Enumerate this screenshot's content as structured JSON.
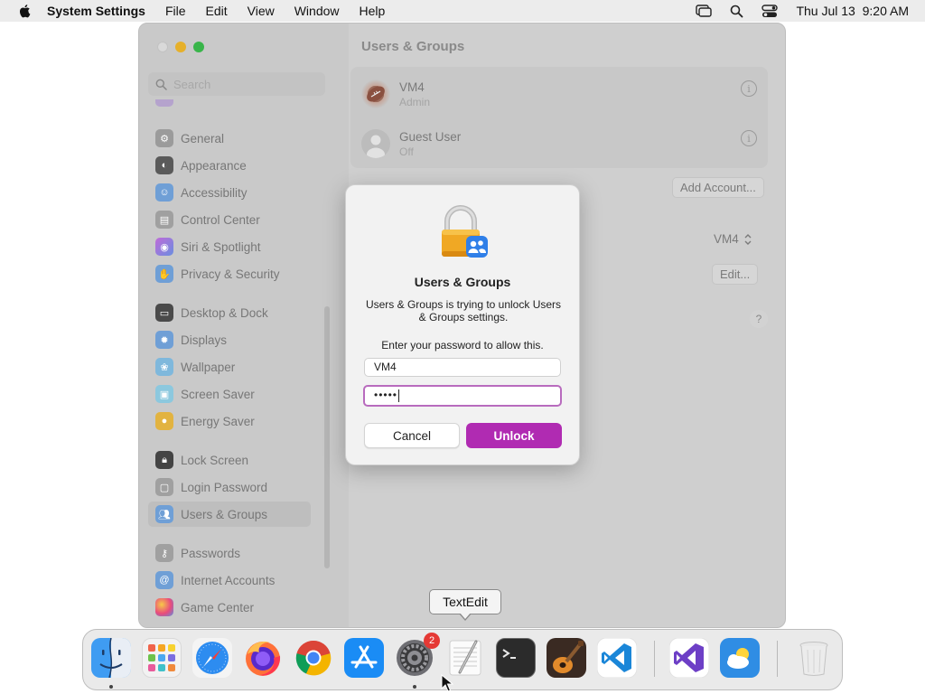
{
  "menubar": {
    "app_name": "System Settings",
    "menus": [
      "File",
      "Edit",
      "View",
      "Window",
      "Help"
    ],
    "datetime": "Thu Jul 13  9:20 AM"
  },
  "window": {
    "title": "Users & Groups",
    "search_placeholder": "Search"
  },
  "sidebar": {
    "items": [
      {
        "label": "General",
        "icon": "gear-icon",
        "color": "#8e8e93"
      },
      {
        "label": "Appearance",
        "icon": "appearance-icon",
        "color": "#1c1c1e"
      },
      {
        "label": "Accessibility",
        "icon": "accessibility-icon",
        "color": "#0a84ff"
      },
      {
        "label": "Control Center",
        "icon": "control-center-icon",
        "color": "#8e8e93"
      },
      {
        "label": "Siri & Spotlight",
        "icon": "siri-icon",
        "color": "#b04bd6"
      },
      {
        "label": "Privacy & Security",
        "icon": "hand-icon",
        "color": "#0a84ff"
      },
      {
        "label": "Desktop & Dock",
        "icon": "desktop-icon",
        "color": "#1c1c1e"
      },
      {
        "label": "Displays",
        "icon": "displays-icon",
        "color": "#0a84ff"
      },
      {
        "label": "Wallpaper",
        "icon": "wallpaper-icon",
        "color": "#34aadc"
      },
      {
        "label": "Screen Saver",
        "icon": "screen-saver-icon",
        "color": "#5ac8fa"
      },
      {
        "label": "Energy Saver",
        "icon": "energy-icon",
        "color": "#f5b400"
      },
      {
        "label": "Lock Screen",
        "icon": "lock-icon",
        "color": "#1c1c1e"
      },
      {
        "label": "Login Password",
        "icon": "login-lock-icon",
        "color": "#8e8e93"
      },
      {
        "label": "Users & Groups",
        "icon": "users-icon",
        "color": "#0a84ff"
      },
      {
        "label": "Passwords",
        "icon": "key-icon",
        "color": "#8e8e93"
      },
      {
        "label": "Internet Accounts",
        "icon": "at-icon",
        "color": "#0a84ff"
      },
      {
        "label": "Game Center",
        "icon": "game-center-icon",
        "color": "#e94b7c"
      }
    ]
  },
  "users": [
    {
      "name": "VM4",
      "role": "Admin"
    },
    {
      "name": "Guest User",
      "role": "Off"
    }
  ],
  "buttons": {
    "add_account": "Add Account...",
    "auto_login_value": "VM4",
    "edit": "Edit...",
    "help": "?"
  },
  "dialog": {
    "title": "Users & Groups",
    "message": "Users & Groups is trying to unlock Users & Groups settings.",
    "prompt": "Enter your password to allow this.",
    "username_value": "VM4",
    "password_value": "•••••",
    "cancel_label": "Cancel",
    "unlock_label": "Unlock",
    "accent_color": "#b02bb2"
  },
  "tooltip": {
    "label": "TextEdit"
  },
  "dock": {
    "apps": [
      "Finder",
      "Launchpad",
      "Safari",
      "Firefox",
      "Chrome",
      "App Store",
      "System Settings",
      "TextEdit",
      "Terminal",
      "GarageBand",
      "Visual Studio Code",
      "Visual Studio",
      "Weather",
      "Trash"
    ],
    "settings_badge": "2"
  }
}
